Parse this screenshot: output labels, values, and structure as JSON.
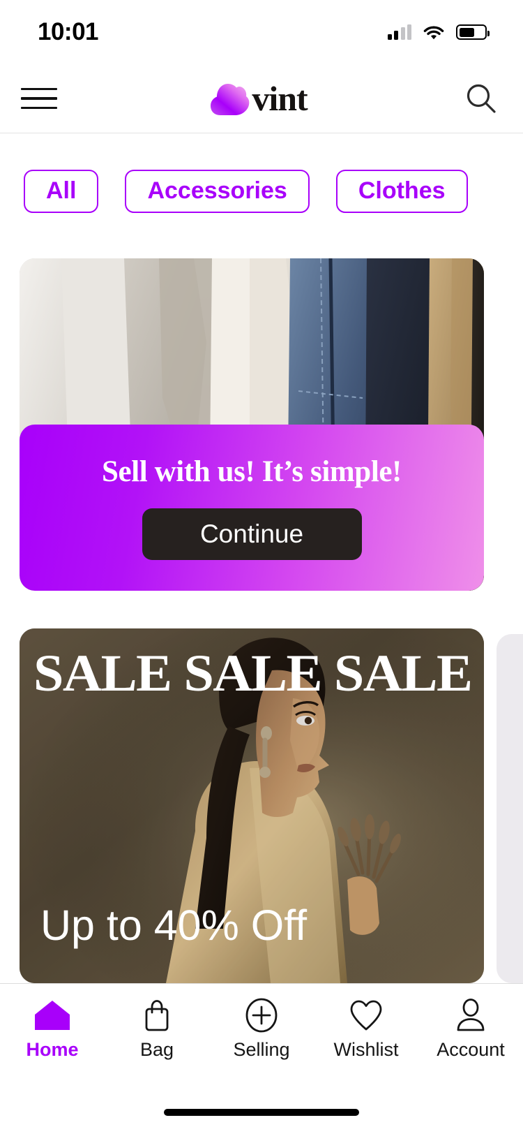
{
  "status_bar": {
    "time": "10:01",
    "signal_icon": "cellular-signal-icon",
    "signal_bars_filled": 2,
    "signal_bars_total": 4,
    "wifi_icon": "wifi-icon",
    "battery_icon": "battery-icon",
    "battery_level_percent": 60
  },
  "header": {
    "menu_icon": "hamburger-menu-icon",
    "brand_name": "vint",
    "brand_mark_icon": "cloud-logo-icon",
    "search_icon": "search-icon"
  },
  "categories": {
    "chips": [
      {
        "label": "All",
        "selected": false
      },
      {
        "label": "Accessories",
        "selected": false
      },
      {
        "label": "Clothes",
        "selected": false
      }
    ]
  },
  "sell_banner": {
    "image_alt": "clothes-rack-photo",
    "headline": "Sell with us! It’s simple!",
    "cta_label": "Continue",
    "gradient_start": "#A800FA",
    "gradient_end": "#EF8FE9",
    "cta_bg": "#26211F"
  },
  "sale_banner": {
    "image_alt": "woman-in-profile-photo",
    "title": "SALE SALE SALE",
    "subtitle": "Up to 40% Off"
  },
  "bottom_nav": {
    "items": [
      {
        "label": "Home",
        "icon": "home-icon",
        "active": true
      },
      {
        "label": "Bag",
        "icon": "bag-icon",
        "active": false
      },
      {
        "label": "Selling",
        "icon": "plus-circle-icon",
        "active": false
      },
      {
        "label": "Wishlist",
        "icon": "heart-icon",
        "active": false
      },
      {
        "label": "Account",
        "icon": "person-icon",
        "active": false
      }
    ],
    "active_color": "#A800FA",
    "inactive_color": "#151515"
  },
  "system": {
    "home_indicator": "home-indicator-bar"
  }
}
